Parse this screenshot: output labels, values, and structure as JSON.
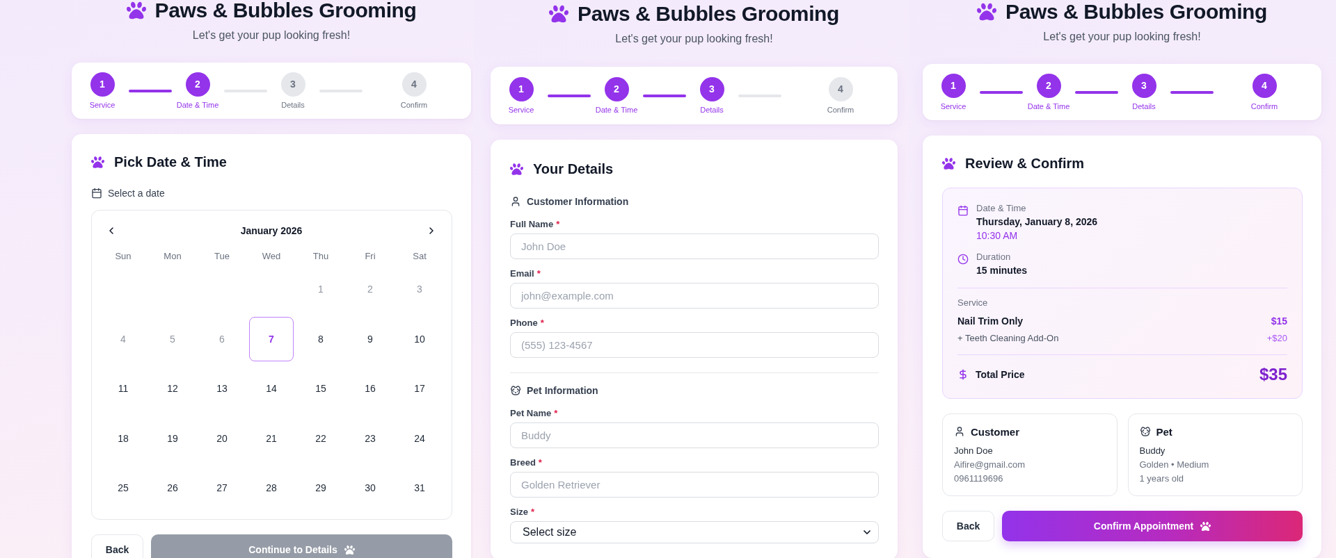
{
  "panels": [
    {
      "header": {
        "title": "Paws & Bubbles Grooming",
        "subtitle": "Let's get your pup looking fresh!"
      },
      "steps": [
        {
          "number": "1",
          "label": "Service",
          "reached": true
        },
        {
          "number": "2",
          "label": "Date & Time",
          "reached": true
        },
        {
          "number": "3",
          "label": "Details",
          "reached": false
        },
        {
          "number": "4",
          "label": "Confirm",
          "reached": false
        }
      ],
      "card": {
        "kind": "date_picker",
        "heading": "Pick Date & Time",
        "prompt": "Select a date",
        "calendar": {
          "month": "January 2026",
          "weekdays": [
            "Sun",
            "Mon",
            "Tue",
            "Wed",
            "Thu",
            "Fri",
            "Sat"
          ],
          "weeks": [
            [
              {
                "kind": "empty"
              },
              {
                "kind": "empty"
              },
              {
                "kind": "empty"
              },
              {
                "kind": "empty"
              },
              {
                "kind": "day",
                "label": "1",
                "disabled": true,
                "today": false,
                "selected": false
              },
              {
                "kind": "day",
                "label": "2",
                "disabled": true,
                "today": false,
                "selected": false
              },
              {
                "kind": "day",
                "label": "3",
                "disabled": true,
                "today": false,
                "selected": false
              }
            ],
            [
              {
                "kind": "day",
                "label": "4",
                "disabled": true,
                "today": false,
                "selected": false
              },
              {
                "kind": "day",
                "label": "5",
                "disabled": true,
                "today": false,
                "selected": false
              },
              {
                "kind": "day",
                "label": "6",
                "disabled": true,
                "today": false,
                "selected": false
              },
              {
                "kind": "day",
                "label": "7",
                "disabled": false,
                "today": true,
                "selected": false
              },
              {
                "kind": "day",
                "label": "8",
                "disabled": false,
                "today": false,
                "selected": false
              },
              {
                "kind": "day",
                "label": "9",
                "disabled": false,
                "today": false,
                "selected": false
              },
              {
                "kind": "day",
                "label": "10",
                "disabled": false,
                "today": false,
                "selected": false
              }
            ],
            [
              {
                "kind": "day",
                "label": "11",
                "disabled": false,
                "today": false,
                "selected": false
              },
              {
                "kind": "day",
                "label": "12",
                "disabled": false,
                "today": false,
                "selected": false
              },
              {
                "kind": "day",
                "label": "13",
                "disabled": false,
                "today": false,
                "selected": false
              },
              {
                "kind": "day",
                "label": "14",
                "disabled": false,
                "today": false,
                "selected": false
              },
              {
                "kind": "day",
                "label": "15",
                "disabled": false,
                "today": false,
                "selected": false
              },
              {
                "kind": "day",
                "label": "16",
                "disabled": false,
                "today": false,
                "selected": false
              },
              {
                "kind": "day",
                "label": "17",
                "disabled": false,
                "today": false,
                "selected": false
              }
            ],
            [
              {
                "kind": "day",
                "label": "18",
                "disabled": false,
                "today": false,
                "selected": false
              },
              {
                "kind": "day",
                "label": "19",
                "disabled": false,
                "today": false,
                "selected": false
              },
              {
                "kind": "day",
                "label": "20",
                "disabled": false,
                "today": false,
                "selected": false
              },
              {
                "kind": "day",
                "label": "21",
                "disabled": false,
                "today": false,
                "selected": false
              },
              {
                "kind": "day",
                "label": "22",
                "disabled": false,
                "today": false,
                "selected": false
              },
              {
                "kind": "day",
                "label": "23",
                "disabled": false,
                "today": false,
                "selected": false
              },
              {
                "kind": "day",
                "label": "24",
                "disabled": false,
                "today": false,
                "selected": false
              }
            ],
            [
              {
                "kind": "day",
                "label": "25",
                "disabled": false,
                "today": false,
                "selected": false
              },
              {
                "kind": "day",
                "label": "26",
                "disabled": false,
                "today": false,
                "selected": false
              },
              {
                "kind": "day",
                "label": "27",
                "disabled": false,
                "today": false,
                "selected": false
              },
              {
                "kind": "day",
                "label": "28",
                "disabled": false,
                "today": false,
                "selected": false
              },
              {
                "kind": "day",
                "label": "29",
                "disabled": false,
                "today": false,
                "selected": false
              },
              {
                "kind": "day",
                "label": "30",
                "disabled": false,
                "today": false,
                "selected": false
              },
              {
                "kind": "day",
                "label": "31",
                "disabled": false,
                "today": false,
                "selected": false
              }
            ]
          ]
        },
        "buttons": [
          {
            "kind": "secondary",
            "label": "Back",
            "disabled": false
          },
          {
            "kind": "primary",
            "label": "Continue to Details",
            "disabled": true
          }
        ]
      }
    },
    {
      "header": {
        "title": "Paws & Bubbles Grooming",
        "subtitle": "Let's get your pup looking fresh!"
      },
      "steps": [
        {
          "number": "1",
          "label": "Service",
          "reached": true
        },
        {
          "number": "2",
          "label": "Date & Time",
          "reached": true
        },
        {
          "number": "3",
          "label": "Details",
          "reached": true
        },
        {
          "number": "4",
          "label": "Confirm",
          "reached": false
        }
      ],
      "card": {
        "kind": "details_form",
        "heading": "Your Details",
        "sections": [
          {
            "kind": "customer",
            "title": "Customer Information",
            "fields": [
              {
                "kind": "text",
                "label": "Full Name",
                "required_mark": "*",
                "placeholder": "John Doe"
              },
              {
                "kind": "text",
                "label": "Email",
                "required_mark": "*",
                "placeholder": "john@example.com"
              },
              {
                "kind": "text",
                "label": "Phone",
                "required_mark": "*",
                "placeholder": "(555) 123-4567"
              }
            ]
          },
          {
            "kind": "pet",
            "title": "Pet Information",
            "fields": [
              {
                "kind": "text",
                "label": "Pet Name",
                "required_mark": "*",
                "placeholder": "Buddy"
              },
              {
                "kind": "text",
                "label": "Breed",
                "required_mark": "*",
                "placeholder": "Golden Retriever"
              },
              {
                "kind": "select",
                "label": "Size",
                "required_mark": "*",
                "value": "Select size"
              }
            ]
          }
        ]
      }
    },
    {
      "header": {
        "title": "Paws & Bubbles Grooming",
        "subtitle": "Let's get your pup looking fresh!"
      },
      "steps": [
        {
          "number": "1",
          "label": "Service",
          "reached": true
        },
        {
          "number": "2",
          "label": "Date & Time",
          "reached": true
        },
        {
          "number": "3",
          "label": "Details",
          "reached": true
        },
        {
          "number": "4",
          "label": "Confirm",
          "reached": true
        }
      ],
      "card": {
        "kind": "review",
        "heading": "Review & Confirm",
        "summary": {
          "schedule": [
            {
              "kind": "date",
              "label": "Date & Time",
              "value": "Thursday, January 8, 2026",
              "detail": "10:30 AM"
            },
            {
              "kind": "duration",
              "label": "Duration",
              "value": "15 minutes"
            }
          ],
          "service_label": "Service",
          "service": {
            "name": "Nail Trim Only",
            "price": "$15"
          },
          "addons": [
            {
              "name": "+ Teeth Cleaning Add-On",
              "price": "+$20"
            }
          ],
          "total": {
            "label": "Total Price",
            "price": "$35"
          }
        },
        "info_cards": [
          {
            "kind": "customer",
            "title": "Customer",
            "lines": [
              "John Doe",
              "Aifire@gmail.com",
              "0961119696"
            ]
          },
          {
            "kind": "pet",
            "title": "Pet",
            "lines": [
              "Buddy",
              "Golden • Medium",
              "1 years old"
            ]
          }
        ],
        "buttons": [
          {
            "kind": "secondary",
            "label": "Back",
            "disabled": false
          },
          {
            "kind": "primary",
            "label": "Confirm Appointment",
            "disabled": false
          }
        ]
      }
    }
  ]
}
